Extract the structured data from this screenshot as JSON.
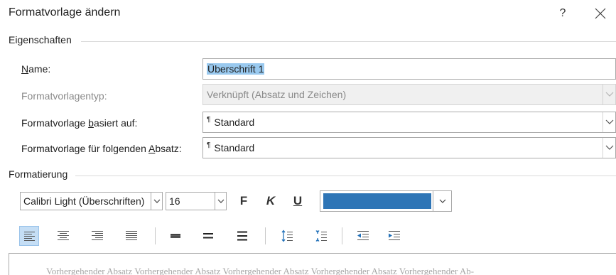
{
  "dialog": {
    "title": "Formatvorlage ändern",
    "help_label": "?"
  },
  "eigenschaften": {
    "section_label": "Eigenschaften",
    "name_label": "Name:",
    "name_value": "Überschrift 1",
    "type_label": "Formatvorlagentyp:",
    "type_value": "Verknüpft (Absatz und Zeichen)",
    "based_on_label": "Formatvorlage basiert auf:",
    "based_on_value": "Standard",
    "next_label": "Formatvorlage für folgenden Absatz:",
    "next_value": "Standard",
    "paragraph_mark": "¶"
  },
  "formatierung": {
    "section_label": "Formatierung",
    "font_value": "Calibri Light (Überschriften)",
    "size_value": "16",
    "bold_label": "F",
    "italic_label": "K",
    "underline_label": "U",
    "font_color": "#2e75b6"
  },
  "toolbar": {
    "icons": [
      "align-left-icon",
      "align-center-icon",
      "align-right-icon",
      "justify-icon",
      "single-spacing-icon",
      "one-half-spacing-icon",
      "double-spacing-icon",
      "increase-paragraph-spacing-icon",
      "decrease-paragraph-spacing-icon",
      "decrease-indent-icon",
      "increase-indent-icon"
    ],
    "active_alignment": "left",
    "accent_color": "#1f6fb8"
  },
  "preview": {
    "text": "Vorhergehender Absatz Vorhergehender Absatz Vorhergehender Absatz Vorhergehender Absatz Vorhergehender Ab-"
  }
}
